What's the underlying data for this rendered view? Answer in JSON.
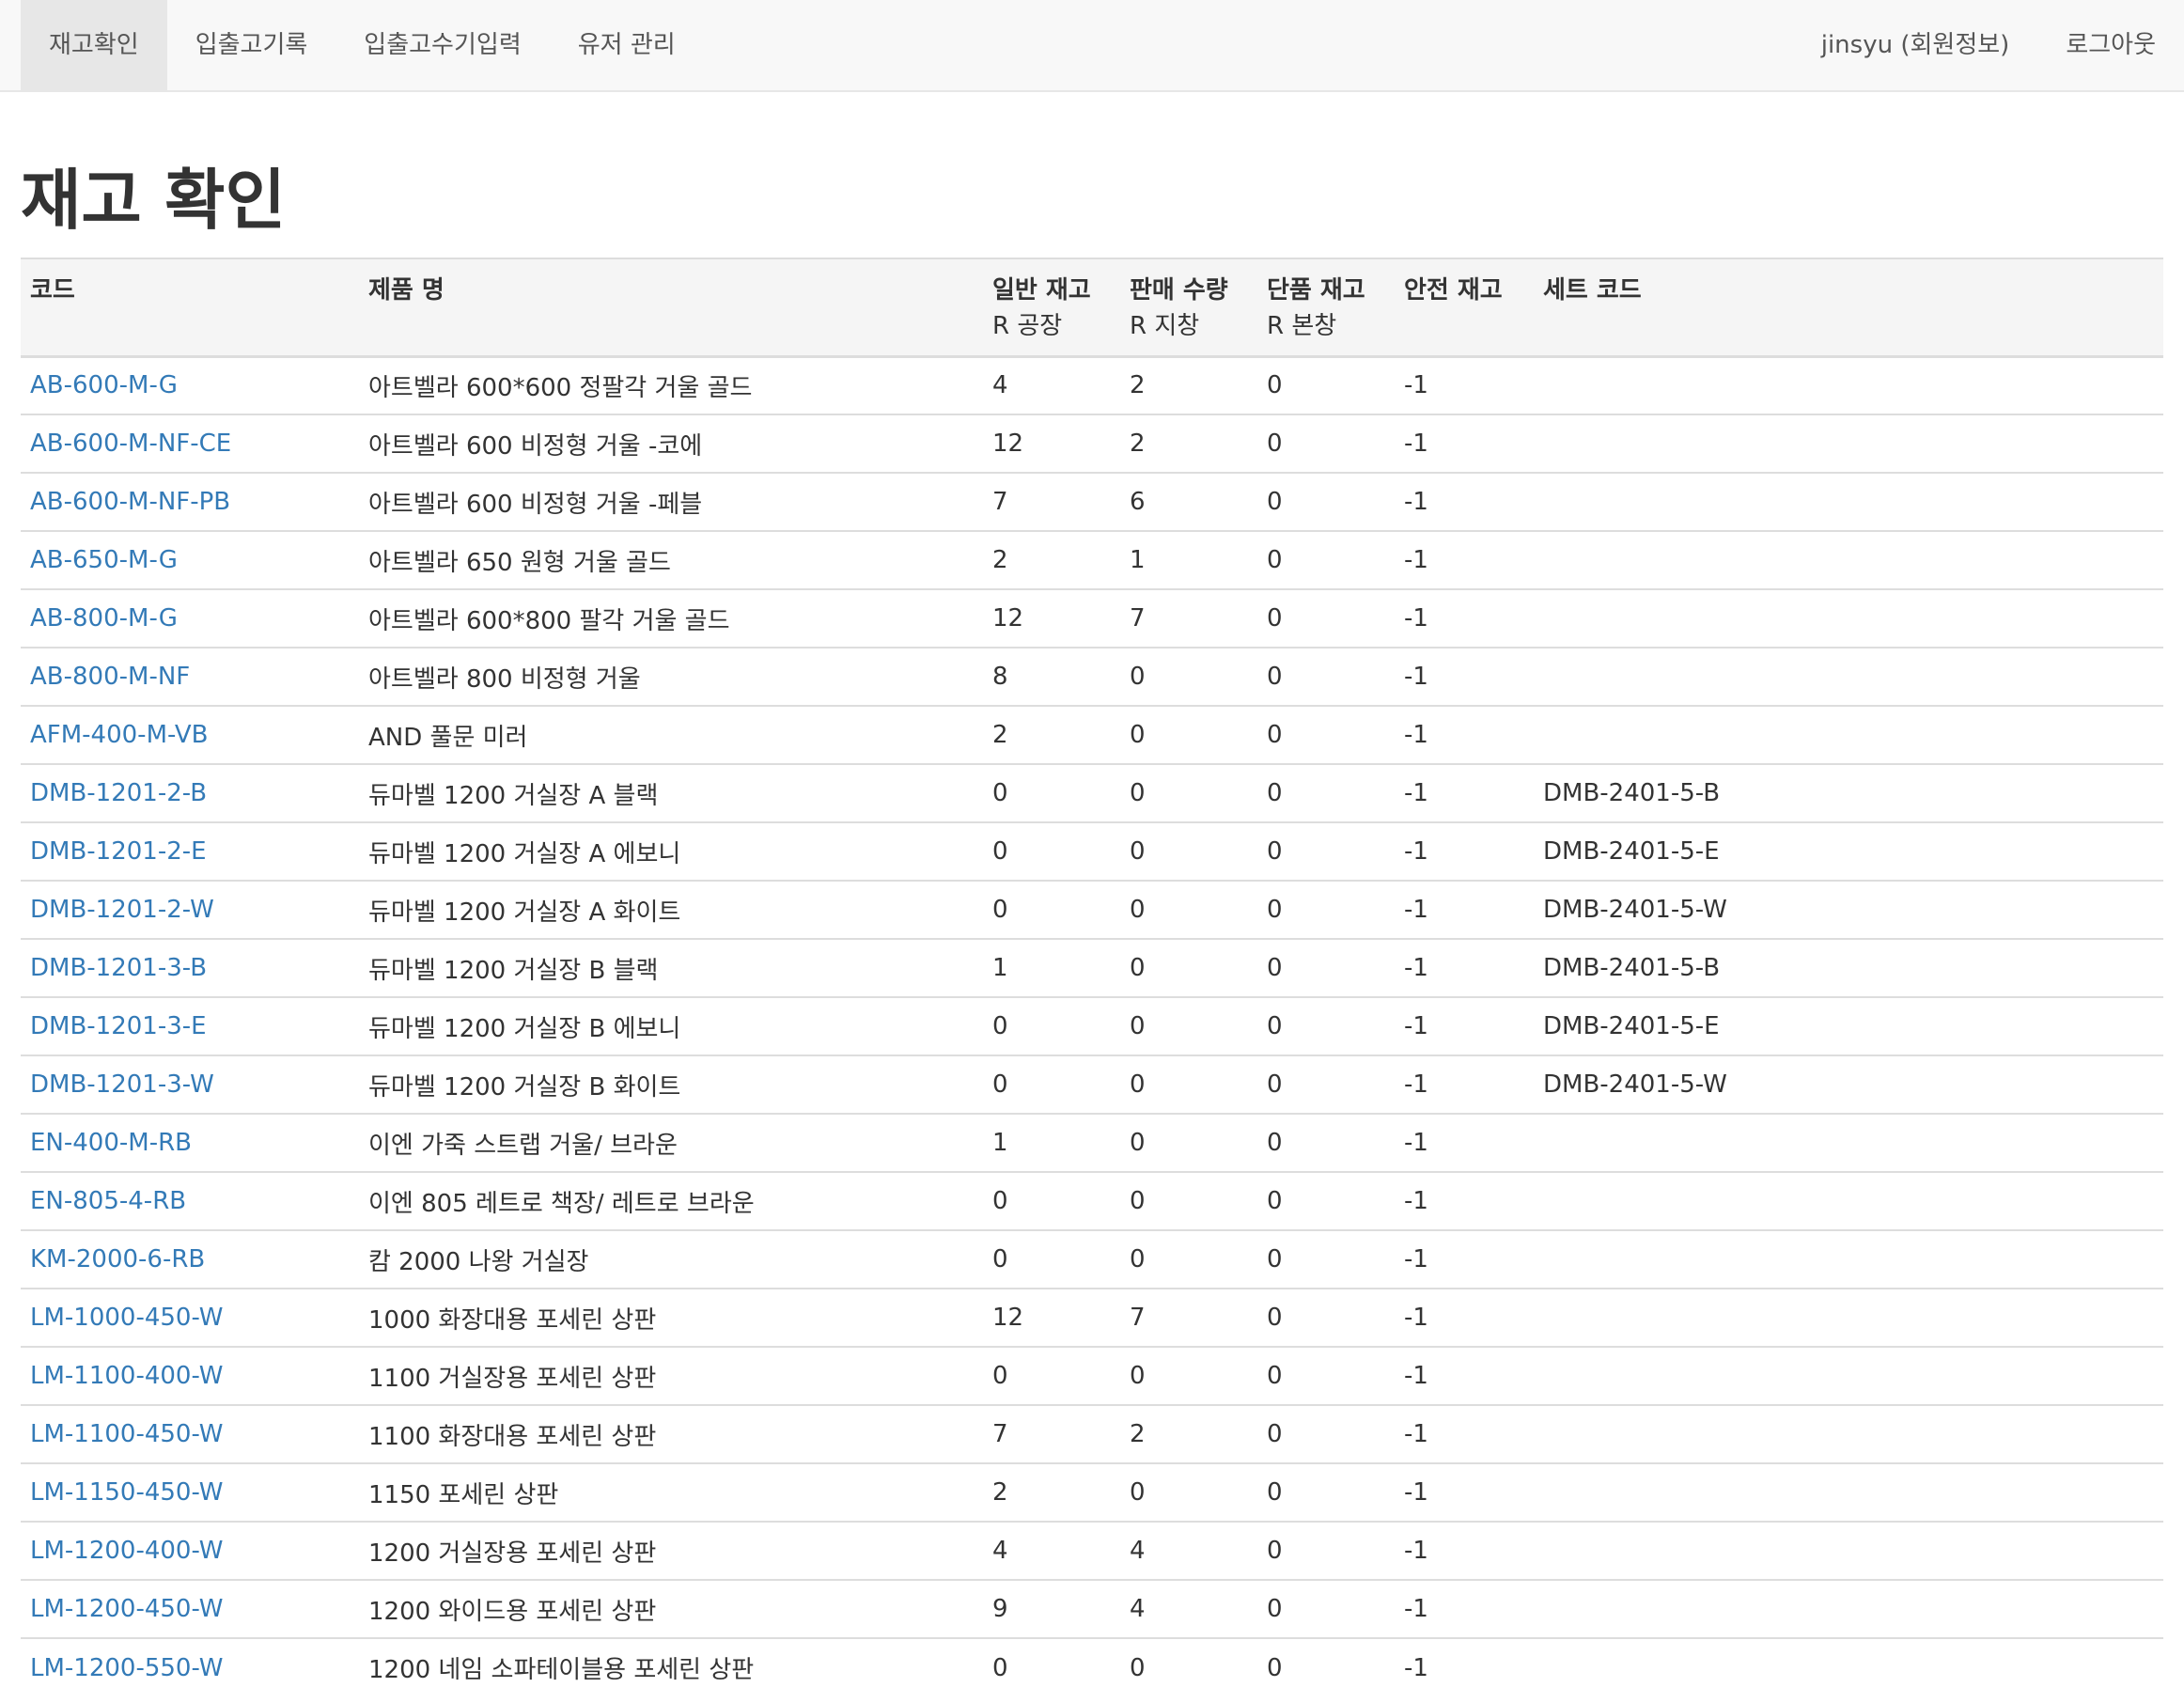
{
  "nav": {
    "left": [
      {
        "label": "재고확인",
        "active": true
      },
      {
        "label": "입출고기록",
        "active": false
      },
      {
        "label": "입출고수기입력",
        "active": false
      },
      {
        "label": "유저 관리",
        "active": false
      }
    ],
    "user_label": "jinsyu (회원정보)",
    "logout_label": "로그아웃"
  },
  "page": {
    "title": "재고 확인"
  },
  "table": {
    "headers": {
      "code": "코드",
      "product_name": "제품 명",
      "general_stock": "일반 재고",
      "general_stock_sub": "R 공장",
      "sales_qty": "판매 수량",
      "sales_qty_sub": "R 지창",
      "single_stock": "단품 재고",
      "single_stock_sub": "R 본창",
      "safety_stock": "안전 재고",
      "set_code": "세트 코드"
    },
    "rows": [
      {
        "code": "AB-600-M-G",
        "name": "아트벨라 600*600 정팔각 거울 골드",
        "general": "4",
        "sales": "2",
        "single": "0",
        "safety": "-1",
        "set_code": ""
      },
      {
        "code": "AB-600-M-NF-CE",
        "name": "아트벨라 600 비정형 거울 -코에",
        "general": "12",
        "sales": "2",
        "single": "0",
        "safety": "-1",
        "set_code": ""
      },
      {
        "code": "AB-600-M-NF-PB",
        "name": "아트벨라 600 비정형 거울 -페블",
        "general": "7",
        "sales": "6",
        "single": "0",
        "safety": "-1",
        "set_code": ""
      },
      {
        "code": "AB-650-M-G",
        "name": "아트벨라 650 원형 거울 골드",
        "general": "2",
        "sales": "1",
        "single": "0",
        "safety": "-1",
        "set_code": ""
      },
      {
        "code": "AB-800-M-G",
        "name": "아트벨라 600*800 팔각 거울 골드",
        "general": "12",
        "sales": "7",
        "single": "0",
        "safety": "-1",
        "set_code": ""
      },
      {
        "code": "AB-800-M-NF",
        "name": "아트벨라 800 비정형 거울",
        "general": "8",
        "sales": "0",
        "single": "0",
        "safety": "-1",
        "set_code": ""
      },
      {
        "code": "AFM-400-M-VB",
        "name": "AND 풀문 미러",
        "general": "2",
        "sales": "0",
        "single": "0",
        "safety": "-1",
        "set_code": ""
      },
      {
        "code": "DMB-1201-2-B",
        "name": "듀마벨 1200 거실장 A 블랙",
        "general": "0",
        "sales": "0",
        "single": "0",
        "safety": "-1",
        "set_code": "DMB-2401-5-B"
      },
      {
        "code": "DMB-1201-2-E",
        "name": "듀마벨 1200 거실장 A 에보니",
        "general": "0",
        "sales": "0",
        "single": "0",
        "safety": "-1",
        "set_code": "DMB-2401-5-E"
      },
      {
        "code": "DMB-1201-2-W",
        "name": "듀마벨 1200 거실장 A 화이트",
        "general": "0",
        "sales": "0",
        "single": "0",
        "safety": "-1",
        "set_code": "DMB-2401-5-W"
      },
      {
        "code": "DMB-1201-3-B",
        "name": "듀마벨 1200 거실장 B 블랙",
        "general": "1",
        "sales": "0",
        "single": "0",
        "safety": "-1",
        "set_code": "DMB-2401-5-B"
      },
      {
        "code": "DMB-1201-3-E",
        "name": "듀마벨 1200 거실장 B 에보니",
        "general": "0",
        "sales": "0",
        "single": "0",
        "safety": "-1",
        "set_code": "DMB-2401-5-E"
      },
      {
        "code": "DMB-1201-3-W",
        "name": "듀마벨 1200 거실장 B 화이트",
        "general": "0",
        "sales": "0",
        "single": "0",
        "safety": "-1",
        "set_code": "DMB-2401-5-W"
      },
      {
        "code": "EN-400-M-RB",
        "name": "이엔 가죽 스트랩 거울/ 브라운",
        "general": "1",
        "sales": "0",
        "single": "0",
        "safety": "-1",
        "set_code": ""
      },
      {
        "code": "EN-805-4-RB",
        "name": "이엔 805 레트로 책장/ 레트로 브라운",
        "general": "0",
        "sales": "0",
        "single": "0",
        "safety": "-1",
        "set_code": ""
      },
      {
        "code": "KM-2000-6-RB",
        "name": "캄 2000 나왕 거실장",
        "general": "0",
        "sales": "0",
        "single": "0",
        "safety": "-1",
        "set_code": ""
      },
      {
        "code": "LM-1000-450-W",
        "name": "1000 화장대용 포세린 상판",
        "general": "12",
        "sales": "7",
        "single": "0",
        "safety": "-1",
        "set_code": ""
      },
      {
        "code": "LM-1100-400-W",
        "name": "1100 거실장용 포세린 상판",
        "general": "0",
        "sales": "0",
        "single": "0",
        "safety": "-1",
        "set_code": ""
      },
      {
        "code": "LM-1100-450-W",
        "name": "1100 화장대용 포세린 상판",
        "general": "7",
        "sales": "2",
        "single": "0",
        "safety": "-1",
        "set_code": ""
      },
      {
        "code": "LM-1150-450-W",
        "name": "1150 포세린 상판",
        "general": "2",
        "sales": "0",
        "single": "0",
        "safety": "-1",
        "set_code": ""
      },
      {
        "code": "LM-1200-400-W",
        "name": "1200 거실장용 포세린 상판",
        "general": "4",
        "sales": "4",
        "single": "0",
        "safety": "-1",
        "set_code": ""
      },
      {
        "code": "LM-1200-450-W",
        "name": "1200 와이드용 포세린 상판",
        "general": "9",
        "sales": "4",
        "single": "0",
        "safety": "-1",
        "set_code": ""
      },
      {
        "code": "LM-1200-550-W",
        "name": "1200 네임 소파테이블용 포세린 상판",
        "general": "0",
        "sales": "0",
        "single": "0",
        "safety": "-1",
        "set_code": ""
      }
    ]
  }
}
